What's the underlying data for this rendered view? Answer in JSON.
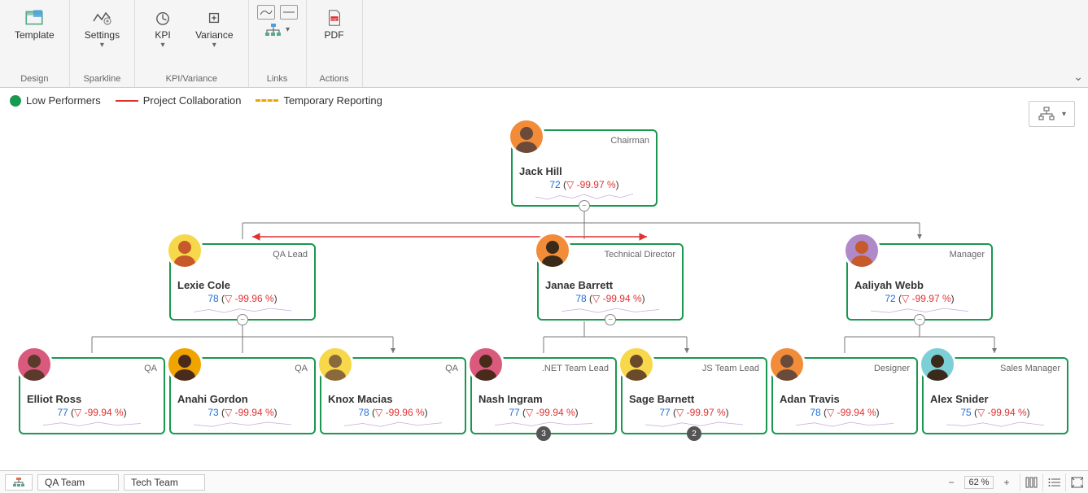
{
  "ribbon": {
    "design": {
      "group": "Design",
      "template": "Template"
    },
    "sparkline": {
      "group": "Sparkline",
      "settings": "Settings"
    },
    "kpi_variance": {
      "group": "KPI/Variance",
      "kpi": "KPI",
      "variance": "Variance"
    },
    "links": {
      "group": "Links"
    },
    "actions": {
      "group": "Actions",
      "pdf": "PDF"
    }
  },
  "legend": {
    "low_performers": {
      "label": "Low Performers",
      "color": "#1a9850"
    },
    "project_collaboration": {
      "label": "Project Collaboration",
      "color": "#e03131"
    },
    "temporary_reporting": {
      "label": "Temporary Reporting",
      "color": "#f0a400"
    }
  },
  "nodes": {
    "jack": {
      "name": "Jack Hill",
      "role": "Chairman",
      "value": "72",
      "variance": "-99.97 %",
      "avatar_bg": "#f28c38"
    },
    "lexie": {
      "name": "Lexie Cole",
      "role": "QA Lead",
      "value": "78",
      "variance": "-99.96 %",
      "avatar_bg": "#f7d84b"
    },
    "janae": {
      "name": "Janae Barrett",
      "role": "Technical Director",
      "value": "78",
      "variance": "-99.94 %",
      "avatar_bg": "#f28c38"
    },
    "aaliyah": {
      "name": "Aaliyah Webb",
      "role": "Manager",
      "value": "72",
      "variance": "-99.97 %",
      "avatar_bg": "#b089c9"
    },
    "elliot": {
      "name": "Elliot Ross",
      "role": "QA",
      "value": "77",
      "variance": "-99.94 %",
      "avatar_bg": "#d95a7c"
    },
    "anahi": {
      "name": "Anahi Gordon",
      "role": "QA",
      "value": "73",
      "variance": "-99.94 %",
      "avatar_bg": "#f0a400"
    },
    "knox": {
      "name": "Knox Macias",
      "role": "QA",
      "value": "78",
      "variance": "-99.96 %",
      "avatar_bg": "#f7d84b"
    },
    "nash": {
      "name": "Nash Ingram",
      "role": ".NET Team Lead",
      "value": "77",
      "variance": "-99.94 %",
      "avatar_bg": "#d95a7c",
      "badge": "3"
    },
    "sage": {
      "name": "Sage Barnett",
      "role": "JS Team Lead",
      "value": "77",
      "variance": "-99.97 %",
      "avatar_bg": "#f7d84b",
      "badge": "2"
    },
    "adan": {
      "name": "Adan Travis",
      "role": "Designer",
      "value": "78",
      "variance": "-99.94 %",
      "avatar_bg": "#f28c38"
    },
    "alex": {
      "name": "Alex Snider",
      "role": "Sales Manager",
      "value": "75",
      "variance": "-99.94 %",
      "avatar_bg": "#7ccfd4"
    }
  },
  "footer": {
    "tabs": {
      "qa": "QA Team",
      "tech": "Tech Team"
    },
    "zoom": "62 %"
  }
}
